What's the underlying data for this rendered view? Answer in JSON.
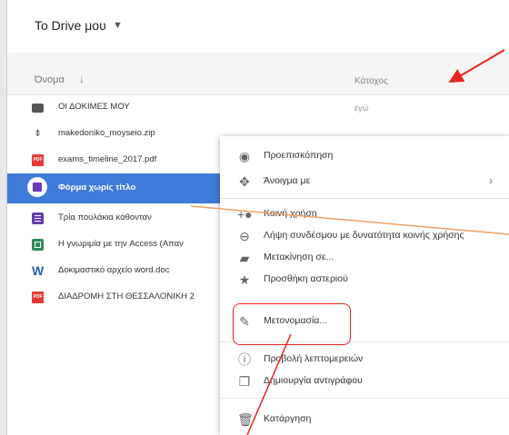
{
  "header": {
    "title": "To Drive μου"
  },
  "columns": {
    "name": "Όνομα",
    "owner": "Κάτοχος"
  },
  "files": [
    {
      "name": "ΟΙ ΔΟΚΙΜΕΣ ΜΟΥ",
      "owner": "εγώ",
      "icon": "folder-icon"
    },
    {
      "name": "makedoniko_moyseio.zip",
      "owner": "",
      "icon": "zip-icon"
    },
    {
      "name": "exams_timeline_2017.pdf",
      "owner": "",
      "icon": "pdf-icon",
      "badge": "PDF"
    },
    {
      "name": "Φόρμα χωρίς τίτλο",
      "owner": "",
      "icon": "form-icon"
    },
    {
      "name": "Τρία πουλάκια κάθονταν",
      "owner": "",
      "icon": "form-icon"
    },
    {
      "name": "Η γνωριμία με την Access (Απαν",
      "owner": "",
      "icon": "access-icon"
    },
    {
      "name": "Δοκιμαστικό αρχείο word.doc",
      "owner": "",
      "icon": "word-icon",
      "badge": "W"
    },
    {
      "name": "ΔΙΑΔΡΟΜΗ ΣΤΗ ΘΕΣΣΑΛΟΝΙΚΗ 2",
      "owner": "",
      "icon": "pdf-icon",
      "badge": "PDF"
    }
  ],
  "menu": [
    {
      "label": "Προεπισκόπηση",
      "icon": "eye-icon"
    },
    {
      "label": "Άνοιγμα με",
      "icon": "open-with-icon",
      "submenu": "›"
    },
    {
      "label": "Κοινή χρήση",
      "icon": "add-person-icon"
    },
    {
      "label": "Λήψη συνδέσμου με δυνατότητα κοινής χρήσης",
      "icon": "link-icon"
    },
    {
      "label": "Μετακίνηση σε...",
      "icon": "move-folder-icon"
    },
    {
      "label": "Προσθήκη αστεριού",
      "icon": "star-icon"
    },
    {
      "label": "Μετονομασία...",
      "icon": "rename-icon"
    },
    {
      "label": "Προβολή λεπτομερειών",
      "icon": "info-icon"
    },
    {
      "label": "Δημιουργία αντιγράφου",
      "icon": "copy-icon"
    },
    {
      "label": "Κατάργηση",
      "icon": "trash-icon"
    }
  ],
  "colors": {
    "selection": "#3f7bd8",
    "annotation_red": "#e5251f",
    "annotation_orange": "#f0a060"
  }
}
